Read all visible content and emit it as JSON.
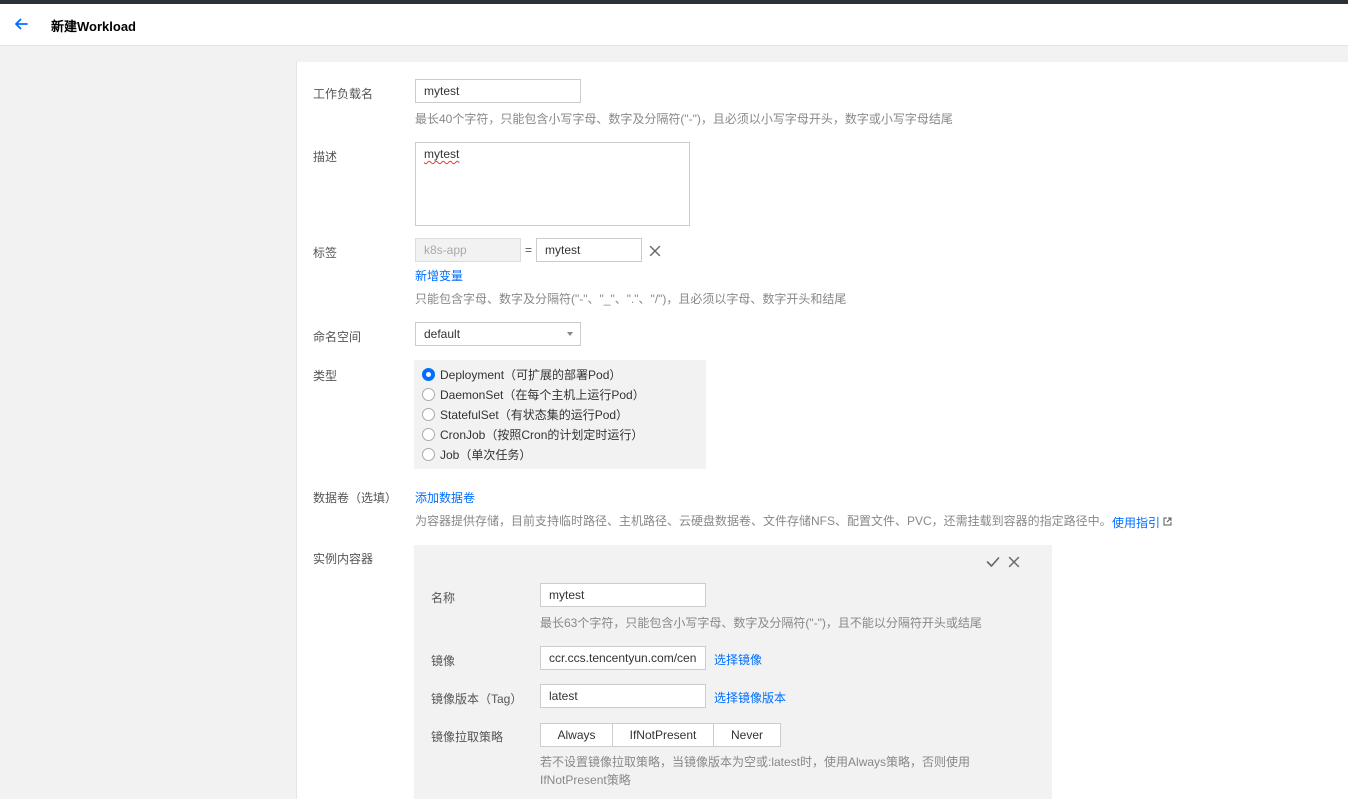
{
  "header": {
    "title": "新建Workload"
  },
  "form": {
    "name": {
      "label": "工作负载名",
      "value": "mytest",
      "hint": "最长40个字符，只能包含小写字母、数字及分隔符(\"-\")，且必须以小写字母开头，数字或小写字母结尾"
    },
    "desc": {
      "label": "描述",
      "value": "mytest"
    },
    "labels": {
      "label": "标签",
      "key": "k8s-app",
      "eq": "=",
      "value": "mytest",
      "add_link": "新增变量",
      "hint": "只能包含字母、数字及分隔符(\"-\"、\"_\"、\".\"、\"/\")，且必须以字母、数字开头和结尾"
    },
    "namespace": {
      "label": "命名空间",
      "value": "default"
    },
    "type": {
      "label": "类型",
      "options": [
        {
          "label": "Deployment（可扩展的部署Pod）",
          "checked": true
        },
        {
          "label": "DaemonSet（在每个主机上运行Pod）",
          "checked": false
        },
        {
          "label": "StatefulSet（有状态集的运行Pod）",
          "checked": false
        },
        {
          "label": "CronJob（按照Cron的计划定时运行）",
          "checked": false
        },
        {
          "label": "Job（单次任务）",
          "checked": false
        }
      ]
    },
    "volume": {
      "label": "数据卷（选填）",
      "add_link": "添加数据卷",
      "hint": "为容器提供存储，目前支持临时路径、主机路径、云硬盘数据卷、文件存储NFS、配置文件、PVC，还需挂载到容器的指定路径中。",
      "guide_link": "使用指引"
    },
    "containers": {
      "label": "实例内容器",
      "name": {
        "label": "名称",
        "value": "mytest",
        "hint": "最长63个字符，只能包含小写字母、数字及分隔符(\"-\")，且不能以分隔符开头或结尾"
      },
      "image": {
        "label": "镜像",
        "value": "ccr.ccs.tencentyun.com/cen",
        "select_link": "选择镜像"
      },
      "tag": {
        "label": "镜像版本（Tag）",
        "value": "latest",
        "select_link": "选择镜像版本"
      },
      "pull_policy": {
        "label": "镜像拉取策略",
        "options": [
          "Always",
          "IfNotPresent",
          "Never"
        ],
        "hint_line1": "若不设置镜像拉取策略，当镜像版本为空或:latest时，使用Always策略，否则使用",
        "hint_line2": "IfNotPresent策略"
      }
    }
  },
  "colors": {
    "accent": "#006eff",
    "topbar": "#2b3138"
  }
}
